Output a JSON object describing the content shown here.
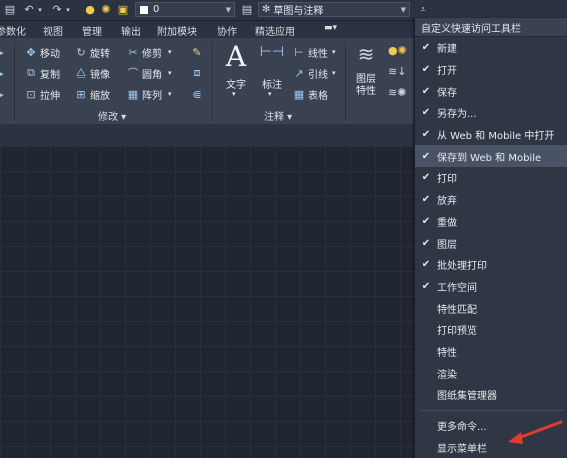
{
  "qat": {
    "layer_value": "0",
    "workspace": "草图与注释"
  },
  "tabs": [
    "参数化",
    "视图",
    "管理",
    "输出",
    "附加模块",
    "协作",
    "精选应用"
  ],
  "ribbon": {
    "modify": {
      "move": "移动",
      "rotate": "旋转",
      "trim": "修剪",
      "copy": "复制",
      "mirror": "镜像",
      "fillet": "圆角",
      "stretch": "拉伸",
      "scale": "缩放",
      "array": "阵列",
      "title": "修改"
    },
    "annotation": {
      "text": "文字",
      "dimension": "标注",
      "linear": "线性",
      "leader": "引线",
      "table": "表格",
      "title": "注释"
    },
    "layers": {
      "properties_l1": "图层",
      "properties_l2": "特性"
    }
  },
  "menu": {
    "header": "自定义快速访问工具栏",
    "items": [
      {
        "label": "新建",
        "checked": true
      },
      {
        "label": "打开",
        "checked": true
      },
      {
        "label": "保存",
        "checked": true
      },
      {
        "label": "另存为...",
        "checked": true
      },
      {
        "label": "从 Web 和 Mobile 中打开",
        "checked": true
      },
      {
        "label": "保存到 Web 和 Mobile",
        "checked": true,
        "highlighted": true
      },
      {
        "label": "打印",
        "checked": true
      },
      {
        "label": "放弃",
        "checked": true
      },
      {
        "label": "重做",
        "checked": true
      },
      {
        "label": "图层",
        "checked": true
      },
      {
        "label": "批处理打印",
        "checked": true
      },
      {
        "label": "工作空间",
        "checked": true
      },
      {
        "label": "特性匹配",
        "checked": false
      },
      {
        "label": "打印预览",
        "checked": false
      },
      {
        "label": "特性",
        "checked": false
      },
      {
        "label": "渲染",
        "checked": false
      },
      {
        "label": "图纸集管理器",
        "checked": false
      }
    ],
    "more_commands": "更多命令...",
    "show_menubar": "显示菜单栏"
  },
  "colors": {
    "annotation_arrow": "#e23b2e"
  }
}
